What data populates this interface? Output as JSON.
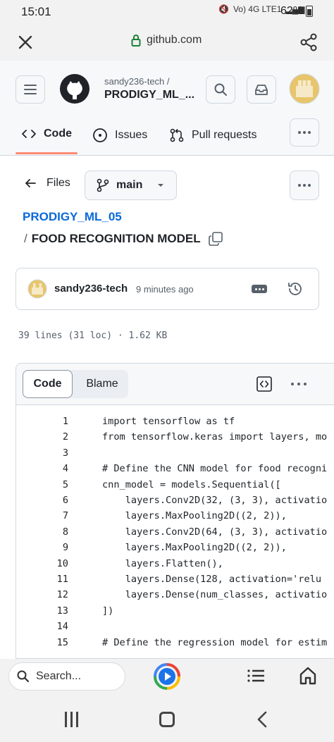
{
  "status_bar": {
    "time": "15:01",
    "network": "Vo) 4G LTE1",
    "battery": "62%"
  },
  "browser": {
    "url": "github.com"
  },
  "header": {
    "owner": "sandy236-tech /",
    "repo": "PRODIGY_ML_...",
    "tabs": [
      {
        "label": "Code",
        "icon": "code-icon"
      },
      {
        "label": "Issues",
        "icon": "issue-icon"
      },
      {
        "label": "Pull requests",
        "icon": "pull-request-icon"
      }
    ]
  },
  "file_nav": {
    "back_label": "Files",
    "branch": "main"
  },
  "breadcrumb": {
    "repo_link": "PRODIGY_ML_05",
    "separator": "/",
    "file_name": "FOOD RECOGNITION MODEL"
  },
  "commit": {
    "author": "sandy236-tech",
    "time": "9 minutes ago"
  },
  "file_stats": "39 lines (31 loc) · 1.62 KB",
  "code_view": {
    "tabs": [
      "Code",
      "Blame"
    ],
    "lines": [
      {
        "n": "1",
        "text": "import tensorflow as tf"
      },
      {
        "n": "2",
        "text": "from tensorflow.keras import layers, mo"
      },
      {
        "n": "3",
        "text": ""
      },
      {
        "n": "4",
        "text": "# Define the CNN model for food recogni"
      },
      {
        "n": "5",
        "text": "cnn_model = models.Sequential(["
      },
      {
        "n": "6",
        "text": "    layers.Conv2D(32, (3, 3), activatio"
      },
      {
        "n": "7",
        "text": "    layers.MaxPooling2D((2, 2)),"
      },
      {
        "n": "8",
        "text": "    layers.Conv2D(64, (3, 3), activatio"
      },
      {
        "n": "9",
        "text": "    layers.MaxPooling2D((2, 2)),"
      },
      {
        "n": "10",
        "text": "    layers.Flatten(),"
      },
      {
        "n": "11",
        "text": "    layers.Dense(128, activation='relu"
      },
      {
        "n": "12",
        "text": "    layers.Dense(num_classes, activatio"
      },
      {
        "n": "13",
        "text": "])"
      },
      {
        "n": "14",
        "text": ""
      },
      {
        "n": "15",
        "text": "# Define the regression model for estim"
      }
    ]
  },
  "bottom_toolbar": {
    "search_placeholder": "Search..."
  }
}
